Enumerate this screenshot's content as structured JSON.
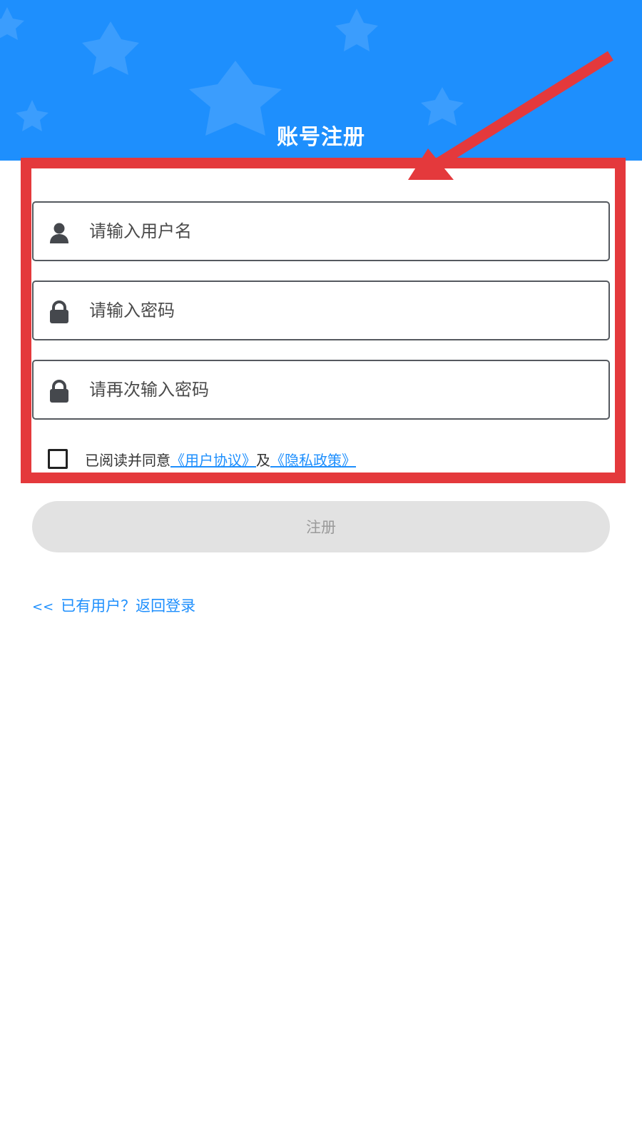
{
  "header": {
    "title": "账号注册",
    "background_color": "#1e8ffd"
  },
  "form": {
    "username": {
      "icon": "user-icon",
      "placeholder": "请输入用户名",
      "value": ""
    },
    "password": {
      "icon": "lock-icon",
      "placeholder": "请输入密码",
      "value": ""
    },
    "confirm_password": {
      "icon": "lock-icon",
      "placeholder": "请再次输入密码",
      "value": ""
    },
    "agreement": {
      "checked": false,
      "prefix": "已阅读并同意",
      "user_agreement": "《用户协议》",
      "conjunction": "及",
      "privacy_policy": "《隐私政策》"
    },
    "submit_label": "注册"
  },
  "back_to_login": {
    "arrows": "<<",
    "label": "已有用户？返回登录"
  },
  "annotation": {
    "color": "#e4393c"
  }
}
